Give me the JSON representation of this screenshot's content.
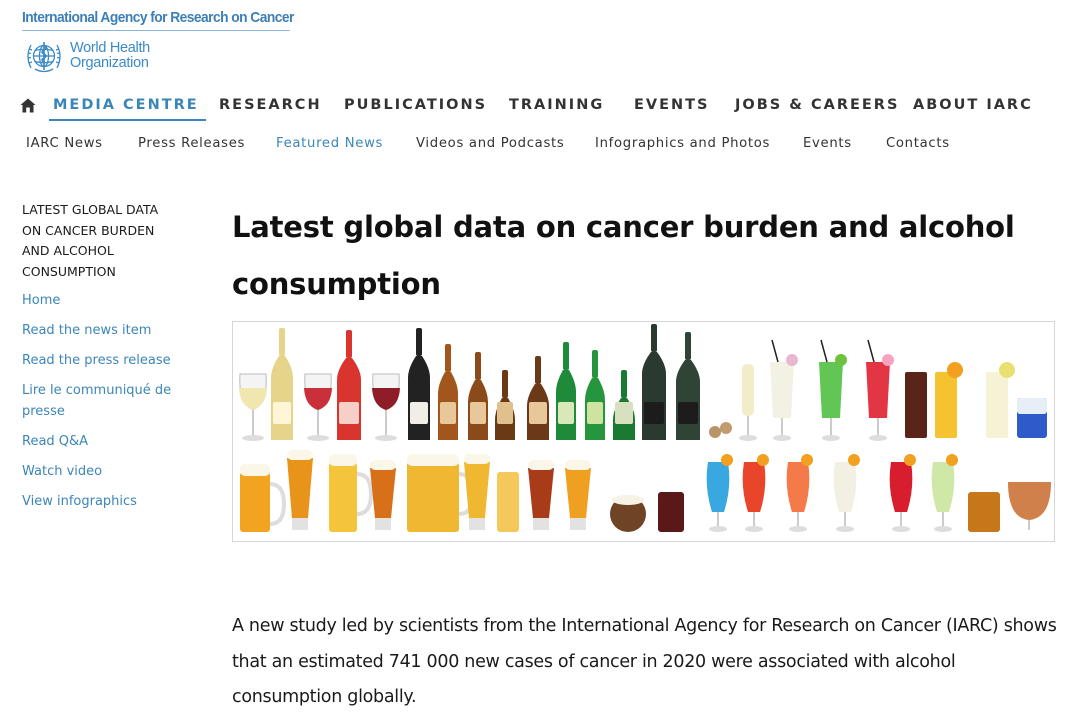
{
  "header": {
    "agency_link": "International Agency for Research on Cancer",
    "who_logo": {
      "line1": "World Health",
      "line2": "Organization",
      "icon": "who-emblem-icon",
      "color": "#3b8ac6"
    }
  },
  "main_nav": {
    "home_icon": "home-icon",
    "items": [
      "MEDIA CENTRE",
      "RESEARCH",
      "PUBLICATIONS",
      "TRAINING",
      "EVENTS",
      "JOBS & CAREERS",
      "ABOUT IARC"
    ],
    "active": "MEDIA CENTRE",
    "accent": "#3b86b8"
  },
  "sub_nav": {
    "items": [
      "IARC News",
      "Press Releases",
      "Featured News",
      "Videos and Podcasts",
      "Infographics and Photos",
      "Events",
      "Contacts"
    ],
    "active": "Featured News"
  },
  "sidebar": {
    "heading": "LATEST GLOBAL DATA ON CANCER BURDEN AND ALCOHOL CONSUMPTION",
    "links": [
      "Home",
      "Read the news item",
      "Read the press release",
      "Lire le communiqué de presse",
      "Read Q&A",
      "Watch video",
      "View infographics"
    ]
  },
  "article": {
    "title": "Latest global data on cancer burden and alcohol consumption",
    "image": "Assorted alcoholic drinks: wine, beer and cocktails",
    "body": "A new study led by scientists from the International Agency for Research on Cancer (IARC) shows that an estimated 741 000 new cases of cancer in 2020 were associated with alcohol consumption globally."
  }
}
